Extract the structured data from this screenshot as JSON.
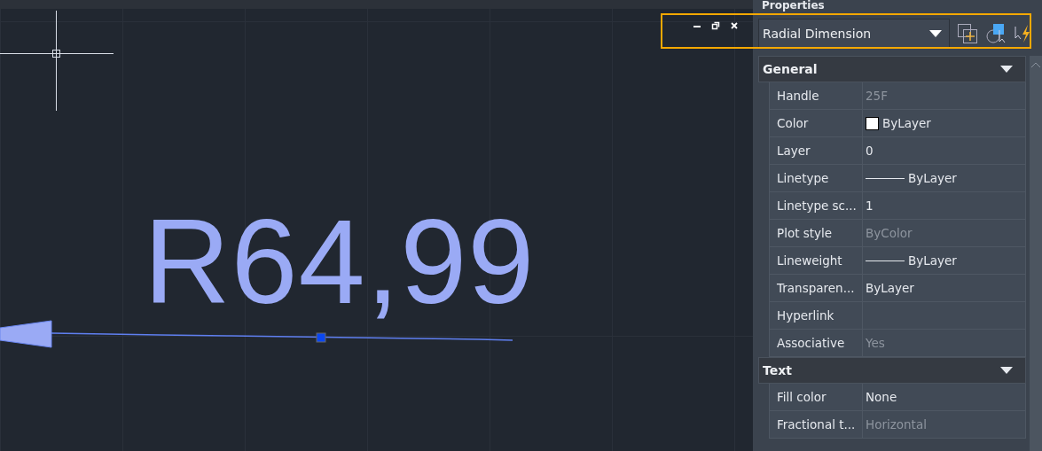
{
  "panel": {
    "title": "Properties",
    "object_type": "Radial Dimension"
  },
  "canvas": {
    "dimension_text": "R64,99"
  },
  "sections": [
    {
      "title": "General",
      "expanded": true,
      "rows": [
        {
          "name": "Handle",
          "value": "25F",
          "kind": "text",
          "readonly": true
        },
        {
          "name": "Color",
          "value": "ByLayer",
          "kind": "swatch",
          "readonly": false
        },
        {
          "name": "Layer",
          "value": "0",
          "kind": "text",
          "readonly": false
        },
        {
          "name": "Linetype",
          "value": "ByLayer",
          "kind": "line",
          "readonly": false
        },
        {
          "name": "Linetype sc...",
          "value": "1",
          "kind": "text",
          "readonly": false
        },
        {
          "name": "Plot style",
          "value": "ByColor",
          "kind": "text",
          "readonly": true
        },
        {
          "name": "Lineweight",
          "value": "ByLayer",
          "kind": "line",
          "readonly": false
        },
        {
          "name": "Transparen...",
          "value": "ByLayer",
          "kind": "text",
          "readonly": false
        },
        {
          "name": "Hyperlink",
          "kind": "text"
        },
        {
          "name": "Associative",
          "value": "Yes",
          "kind": "text",
          "readonly": true
        }
      ]
    },
    {
      "title": "Text",
      "expanded": true,
      "rows": [
        {
          "name": "Fill color",
          "value": "None",
          "kind": "text",
          "readonly": false
        },
        {
          "name": "Fractional t...",
          "value": "Horizontal",
          "kind": "text",
          "readonly": true
        }
      ]
    }
  ]
}
